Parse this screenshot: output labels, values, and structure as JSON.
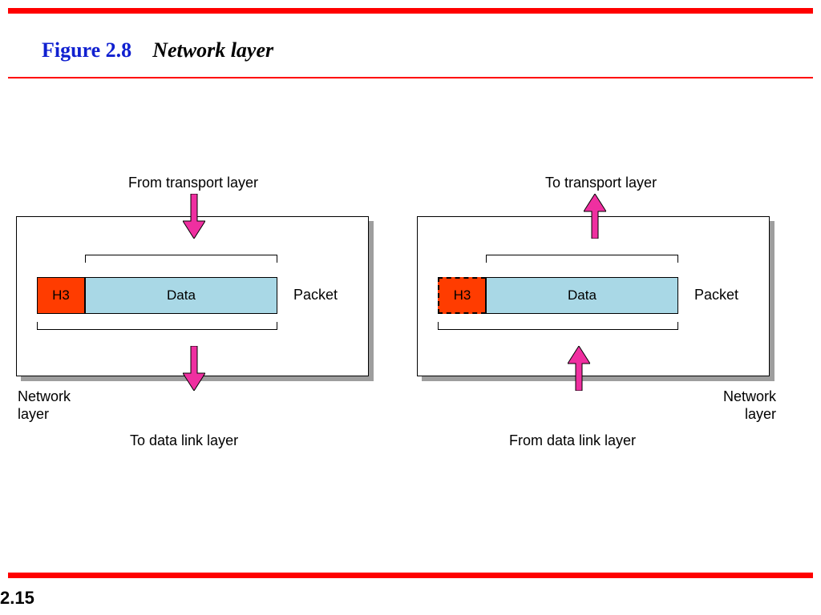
{
  "figure": {
    "number": "Figure 2.8",
    "title": "Network layer"
  },
  "page": "2.15",
  "colors": {
    "accent": "#ef2fa0",
    "header": "#ff3c00",
    "data": "#a9d8e6"
  },
  "left": {
    "top_label": "From transport layer",
    "h3": "H3",
    "data": "Data",
    "packet_label": "Packet",
    "bottom_label": "To data link layer",
    "layer_label_line1": "Network",
    "layer_label_line2": "layer"
  },
  "right": {
    "top_label": "To transport layer",
    "h3": "H3",
    "data": "Data",
    "packet_label": "Packet",
    "bottom_label": "From data link layer",
    "layer_label_line1": "Network",
    "layer_label_line2": "layer"
  }
}
